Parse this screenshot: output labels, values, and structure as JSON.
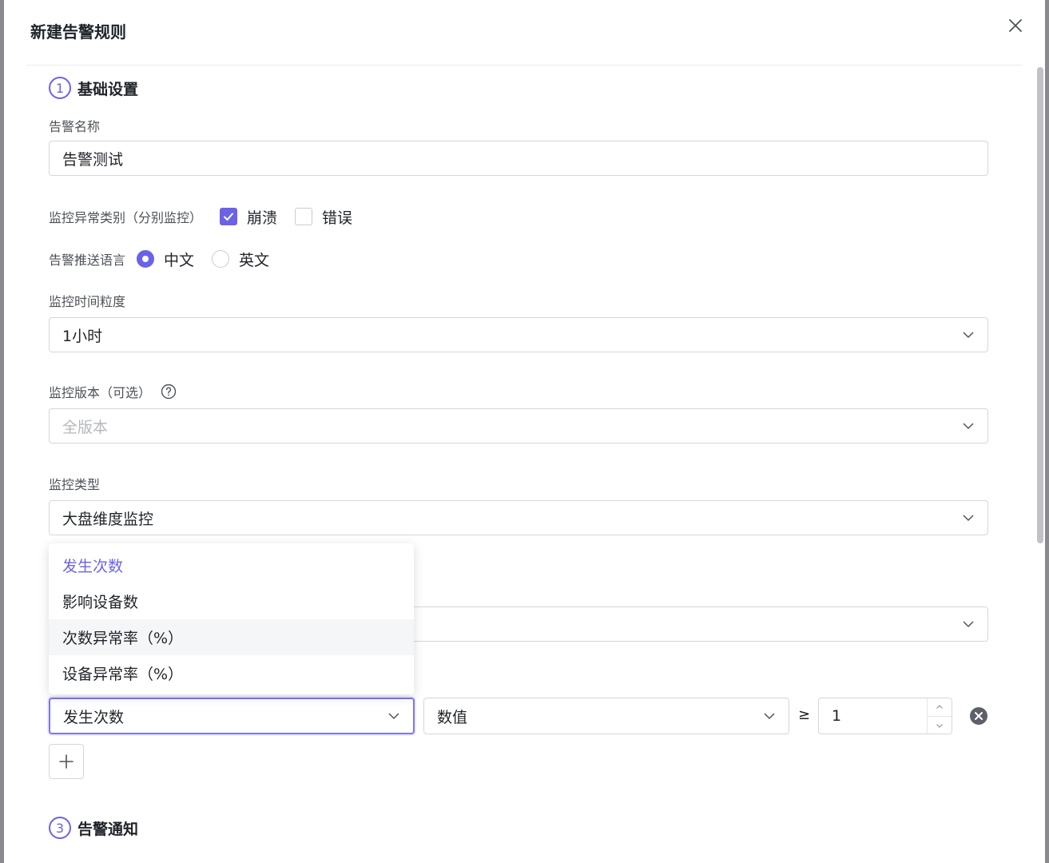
{
  "modal": {
    "title": "新建告警规则"
  },
  "basic": {
    "step_number": "1",
    "title": "基础设置",
    "name_label": "告警名称",
    "name_value": "告警测试",
    "exception_label": "监控异常类别（分别监控）",
    "exception_options": [
      {
        "label": "崩溃",
        "checked": true
      },
      {
        "label": "错误",
        "checked": false
      }
    ],
    "language_label": "告警推送语言",
    "language_options": [
      {
        "label": "中文",
        "selected": true
      },
      {
        "label": "英文",
        "selected": false
      }
    ],
    "granularity_label": "监控时间粒度",
    "granularity_value": "1小时",
    "version_label": "监控版本（可选）",
    "version_placeholder": "全版本",
    "type_label": "监控类型",
    "type_value": "大盘维度监控"
  },
  "metric_dropdown": {
    "options": [
      "发生次数",
      "影响设备数",
      "次数异常率（%）",
      "设备异常率（%）"
    ],
    "selected_index": 0,
    "hover_index": 2
  },
  "condition": {
    "metric_value": "发生次数",
    "mode_value": "数值",
    "operator": "≥",
    "threshold": "1"
  },
  "notify": {
    "step_number": "3",
    "title": "告警通知"
  },
  "colors": {
    "accent": "#6b62e8"
  }
}
